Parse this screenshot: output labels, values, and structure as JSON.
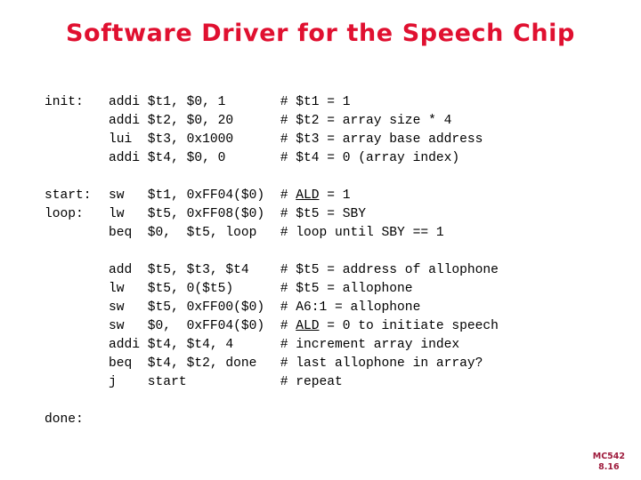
{
  "slide": {
    "title": "Software Driver for the Speech Chip",
    "background_color": "#ffffff",
    "title_color": "#e01030",
    "code_color": "#000000",
    "footer_color": "#9e1b3c"
  },
  "code": {
    "blocks": [
      {
        "lines": [
          {
            "label": "init:",
            "mnemonic": "addi",
            "operands": "$t1, $0, 1",
            "comment": "# $t1 = 1"
          },
          {
            "label": "",
            "mnemonic": "addi",
            "operands": "$t2, $0, 20",
            "comment": "# $t2 = array size * 4"
          },
          {
            "label": "",
            "mnemonic": "lui",
            "operands": "$t3, 0x1000",
            "comment": "# $t3 = array base address"
          },
          {
            "label": "",
            "mnemonic": "addi",
            "operands": "$t4, $0, 0",
            "comment": "# $t4 = 0 (array index)"
          }
        ]
      },
      {
        "lines": [
          {
            "label": "start:",
            "mnemonic": "sw",
            "operands": "$t1, 0xFF04($0)",
            "comment_pre": "# ",
            "comment_underline": "ALD",
            "comment_post": " = 1"
          },
          {
            "label": "loop:",
            "mnemonic": "lw",
            "operands": "$t5, 0xFF08($0)",
            "comment": "# $t5 = SBY"
          },
          {
            "label": "",
            "mnemonic": "beq",
            "operands": "$0,  $t5, loop",
            "comment": "# loop until SBY == 1"
          }
        ]
      },
      {
        "lines": [
          {
            "label": "",
            "mnemonic": "add",
            "operands": "$t5, $t3, $t4",
            "comment": "# $t5 = address of allophone"
          },
          {
            "label": "",
            "mnemonic": "lw",
            "operands": "$t5, 0($t5)",
            "comment": "# $t5 = allophone"
          },
          {
            "label": "",
            "mnemonic": "sw",
            "operands": "$t5, 0xFF00($0)",
            "comment": "# A6:1 = allophone"
          },
          {
            "label": "",
            "mnemonic": "sw",
            "operands": "$0,  0xFF04($0)",
            "comment_pre": "# ",
            "comment_underline": "ALD",
            "comment_post": " = 0 to initiate speech"
          },
          {
            "label": "",
            "mnemonic": "addi",
            "operands": "$t4, $t4, 4",
            "comment": "# increment array index"
          },
          {
            "label": "",
            "mnemonic": "beq",
            "operands": "$t4, $t2, done",
            "comment": "# last allophone in array?"
          },
          {
            "label": "",
            "mnemonic": "j",
            "operands": "start",
            "comment": "# repeat"
          }
        ]
      },
      {
        "lines": [
          {
            "label": "done:",
            "mnemonic": "",
            "operands": "",
            "comment": ""
          }
        ]
      }
    ]
  },
  "footer": {
    "course": "MC542",
    "page": "8.16"
  }
}
